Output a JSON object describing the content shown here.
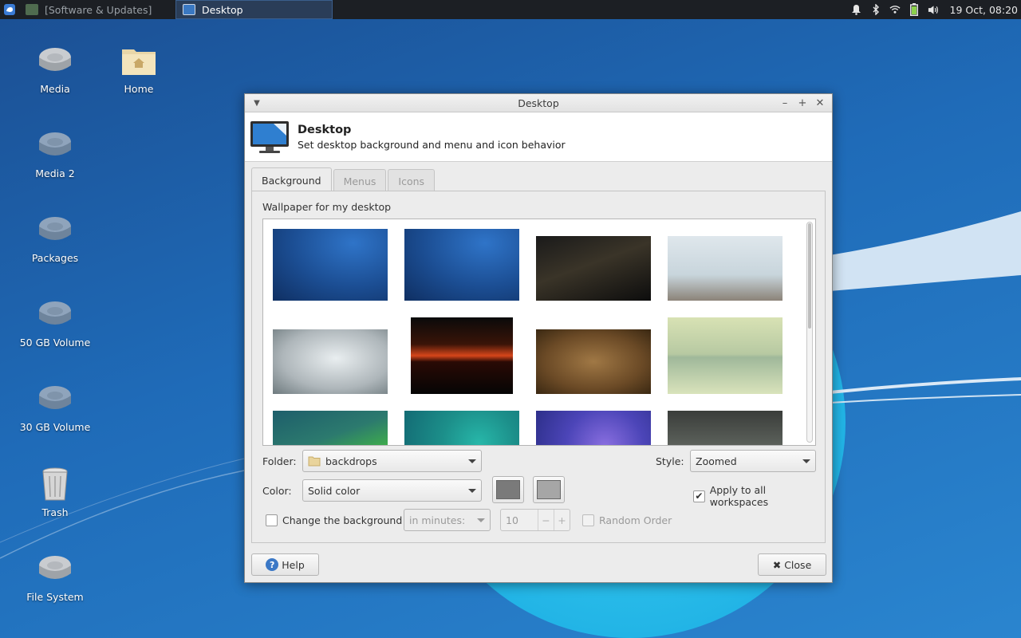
{
  "panel": {
    "tasks": [
      {
        "label": "[Software & Updates]",
        "icon": "software-updates-icon"
      },
      {
        "label": "Desktop",
        "icon": "desktop-monitor-icon"
      }
    ],
    "clock": "19 Oct, 08:20",
    "tray_icons": [
      "notification-bell-icon",
      "bluetooth-icon",
      "wifi-icon",
      "battery-icon",
      "volume-icon"
    ]
  },
  "desktop_icons": [
    {
      "label": "Media",
      "icon": "drive-icon"
    },
    {
      "label": "Home",
      "icon": "home-folder-icon"
    },
    {
      "label": "Media 2",
      "icon": "drive-icon"
    },
    {
      "label": "Packages",
      "icon": "drive-icon"
    },
    {
      "label": "50 GB Volume",
      "icon": "drive-icon"
    },
    {
      "label": "30 GB Volume",
      "icon": "drive-icon"
    },
    {
      "label": "Trash",
      "icon": "trash-icon"
    },
    {
      "label": "File System",
      "icon": "drive-icon"
    }
  ],
  "dialog": {
    "window_title": "Desktop",
    "header_title": "Desktop",
    "header_subtitle": "Set desktop background and menu and icon behavior",
    "tabs": [
      "Background",
      "Menus",
      "Icons"
    ],
    "active_tab": "Background",
    "wallpaper_label": "Wallpaper for my desktop",
    "wallpapers": [
      "blue-aurora-1",
      "blue-aurora-2",
      "milky-way-night",
      "misty-pier",
      "frosty-plant",
      "red-sunset",
      "stone-carving",
      "tree-reflection",
      "teal-green-wave",
      "teal-circles",
      "purple-circle",
      "grey-sailboat"
    ],
    "folder_label": "Folder:",
    "folder_value": "backdrops",
    "style_label": "Style:",
    "style_value": "Zoomed",
    "color_label": "Color:",
    "color_value": "Solid color",
    "primary_color": "#7a7a7a",
    "secondary_color": "#a6a6a6",
    "apply_all_label": "Apply to all workspaces",
    "apply_all_checked": true,
    "change_bg_label": "Change the background",
    "change_bg_checked": false,
    "interval_unit": "in minutes:",
    "interval_value": "10",
    "random_order_label": "Random Order",
    "help_label": "Help",
    "close_label": "Close"
  }
}
